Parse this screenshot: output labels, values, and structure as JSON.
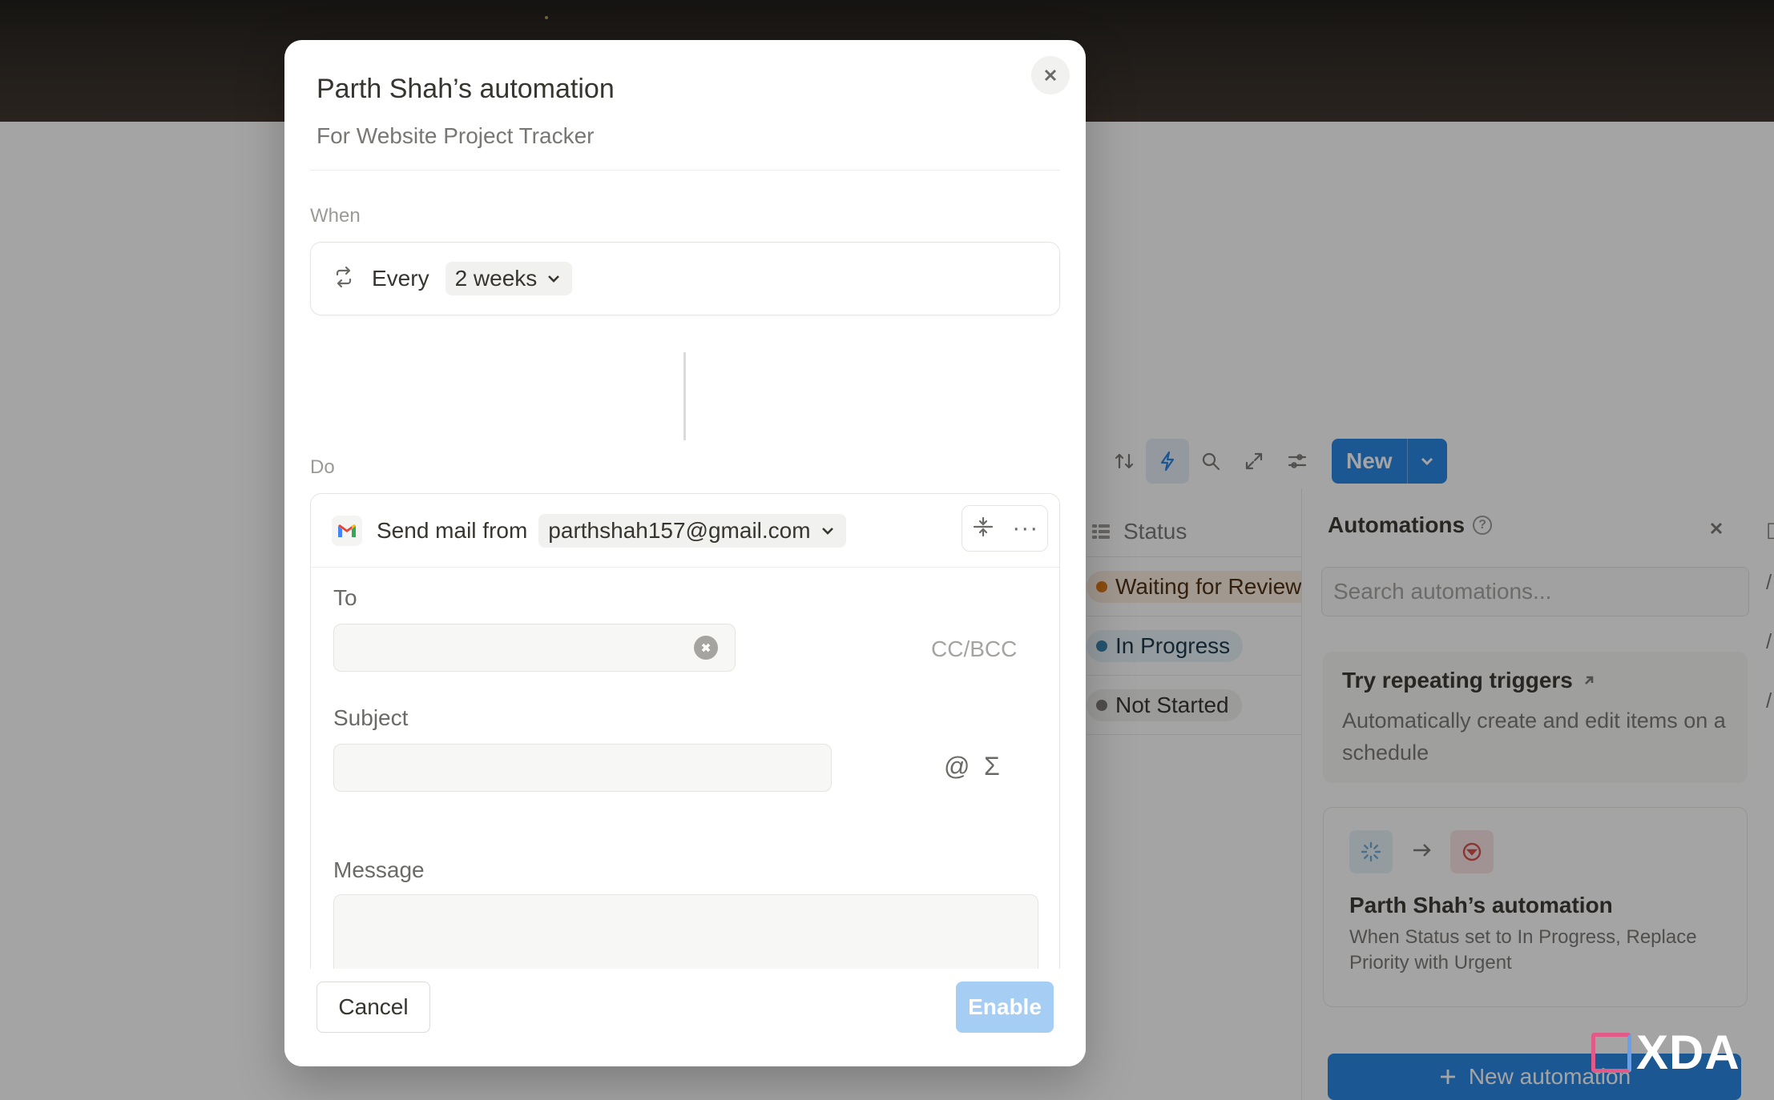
{
  "background": {
    "toolbar": {
      "new_label": "New"
    },
    "table": {
      "status_header": "Status",
      "rows": [
        {
          "status": "Waiting for Review",
          "color": "#d9730d"
        },
        {
          "status": "In Progress",
          "color": "#337ea9"
        },
        {
          "status": "Not Started",
          "color": "#787774"
        }
      ]
    },
    "automations_panel": {
      "title": "Automations",
      "search_placeholder": "Search automations...",
      "tip_title": "Try repeating triggers",
      "tip_desc": "Automatically create and edit items on a schedule",
      "card_name": "Parth Shah’s automation",
      "card_desc": "When Status set to In Progress, Replace Priority with Urgent",
      "new_automation_label": "New automation"
    },
    "watermark": "XDA"
  },
  "modal": {
    "title": "Parth Shah’s automation",
    "subtitle": "For Website Project Tracker",
    "when": {
      "label": "When",
      "every_text": "Every",
      "interval": "2 weeks"
    },
    "do": {
      "label": "Do",
      "action_text": "Send mail from",
      "sender": "parthshah157@gmail.com",
      "to_label": "To",
      "to_value": "",
      "cc_bcc_label": "CC/BCC",
      "subject_label": "Subject",
      "subject_value": "",
      "mention_symbol": "@",
      "formula_symbol": "Σ",
      "message_label": "Message"
    },
    "footer": {
      "cancel_label": "Cancel",
      "enable_label": "Enable"
    }
  },
  "colors": {
    "accent": "#2383e2",
    "enable_disabled": "#a6cdf4"
  }
}
